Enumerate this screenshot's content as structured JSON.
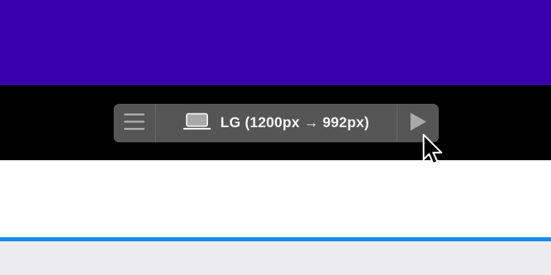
{
  "colors": {
    "banner": "#3a00ab",
    "black_strip": "#000000",
    "white_area": "#ffffff",
    "accent_line": "#1a8cef",
    "bottom_bar": "#ececef",
    "toolbar_bg": "#555555",
    "toolbar_text": "#f2f2f2",
    "icon_color": "#a9a9a9"
  },
  "toolbar": {
    "menu_icon": "hamburger-menu-icon",
    "device_icon": "laptop-icon",
    "device_label": "LG (1200px → 992px)",
    "play_icon": "play-icon"
  },
  "cursor": {
    "icon": "mouse-pointer-icon"
  }
}
